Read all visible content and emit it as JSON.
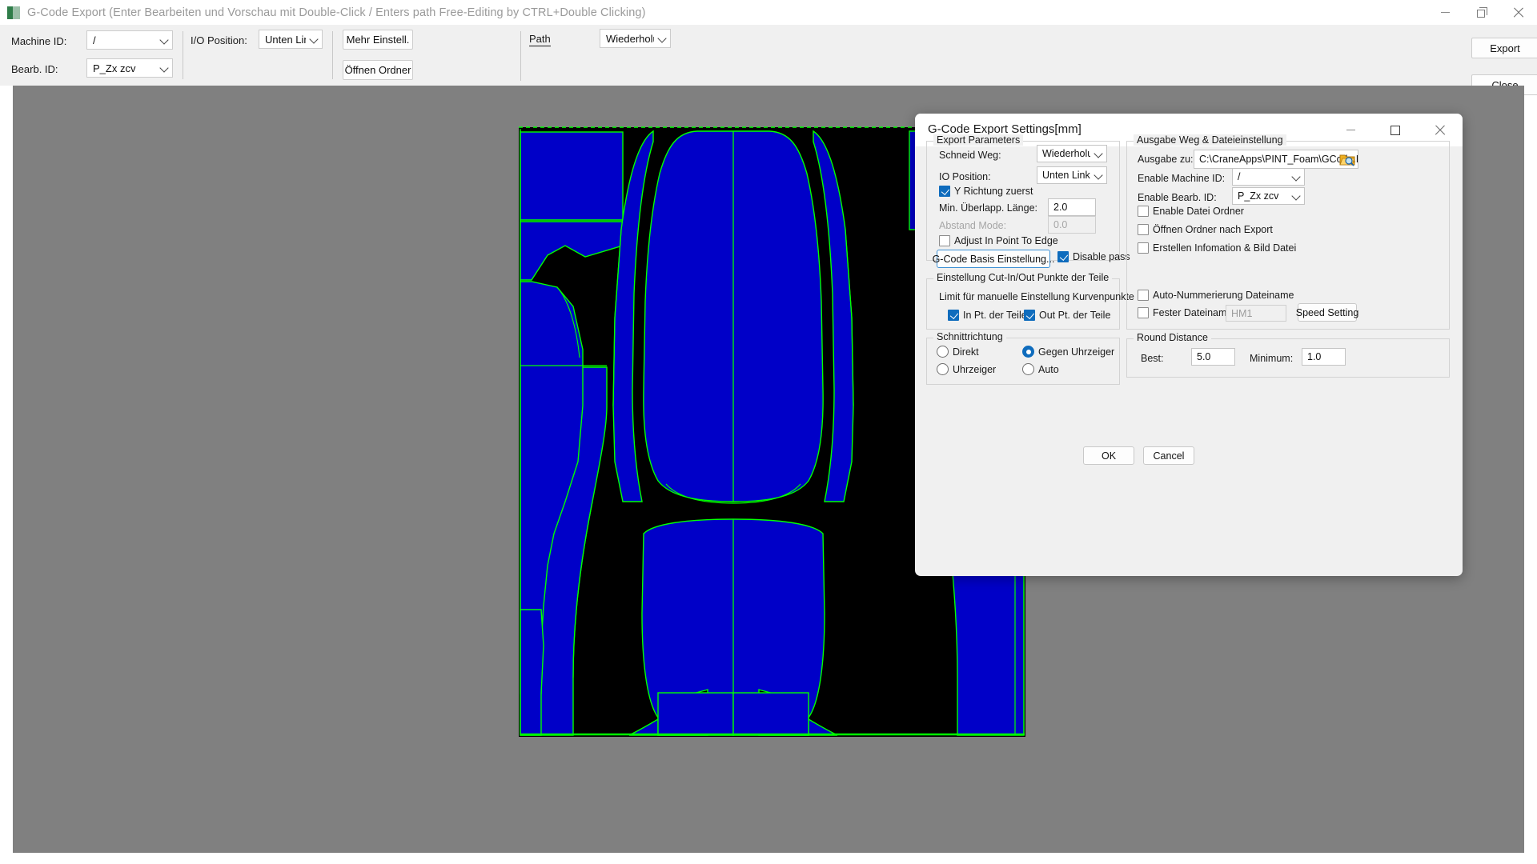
{
  "main_window": {
    "title": "G-Code Export (Enter Bearbeiten und Vorschau mit Double-Click / Enters path Free-Editing by CTRL+Double Clicking)",
    "icon": "app-icon",
    "controls": {
      "minimize": "minimize-icon",
      "restore": "restore-icon",
      "close": "close-icon"
    }
  },
  "toolbar": {
    "machine_id_label": "Machine ID:",
    "machine_id_value": "/",
    "bearb_id_label": "Bearb. ID:",
    "bearb_id_value": "P_Zx zcv",
    "io_position_label": "I/O Position:",
    "io_position_value": "Unten Linl",
    "y_richtung_label": "Y Richtung zuerst",
    "y_richtung_checked": true,
    "mehr_einstell_label": "Mehr Einstell.",
    "oeffnen_ordner_label": "Öffnen Ordner",
    "path_label": "Path",
    "path_value": "Wiederholu",
    "export_label": "Export",
    "close_label": "Close"
  },
  "dialog": {
    "title": "G-Code Export Settings[mm]",
    "controls": {
      "minimize": "minimize-icon",
      "maximize": "maximize-icon",
      "close": "close-icon"
    },
    "export_parameters": {
      "group_label": "Export Parameters",
      "schneid_weg_label": "Schneid Weg:",
      "schneid_weg_value": "Wiederholung",
      "io_position_label": "IO Position:",
      "io_position_value": "Unten Links",
      "y_richtung_label": "Y Richtung zuerst",
      "y_richtung_checked": true,
      "min_ueberlapp_label": "Min. Überlapp. Länge:",
      "min_ueberlapp_value": "2.0",
      "abstand_mode_label": "Abstand Mode:",
      "abstand_mode_value": "0.0",
      "abstand_mode_disabled": true,
      "adjust_in_point_label": "Adjust In Point To Edge",
      "adjust_in_point_checked": false,
      "gcode_basis_button": "G-Code Basis Einstellung...",
      "disable_pass_label": "Disable pass",
      "disable_pass_checked": true
    },
    "cut_points": {
      "group_label": "Einstellung Cut-In/Out Punkte der Teile",
      "limit_label": "Limit für manuelle Einstellung Kurvenpunkte",
      "in_pt_label": "In Pt. der Teile",
      "in_pt_checked": true,
      "out_pt_label": "Out Pt. der Teile",
      "out_pt_checked": true
    },
    "schnittrichtung": {
      "group_label": "Schnittrichtung",
      "options": [
        {
          "label": "Direkt",
          "selected": false
        },
        {
          "label": "Gegen Uhrzeiger",
          "selected": true
        },
        {
          "label": "Uhrzeiger",
          "selected": false
        },
        {
          "label": "Auto",
          "selected": false
        }
      ]
    },
    "ausgabe": {
      "group_label": "Ausgabe Weg & Dateieinstellung",
      "ausgabe_zu_label": "Ausgabe zu:",
      "ausgabe_zu_value": "C:\\CraneApps\\PINT_Foam\\GCode.Fil",
      "browse_icon": "folder-browse-icon",
      "enable_machine_id_label": "Enable Machine ID:",
      "enable_machine_id_value": "/",
      "enable_bearb_id_label": "Enable Bearb. ID:",
      "enable_bearb_id_value": "P_Zx zcv",
      "enable_datei_ordner_label": "Enable Datei Ordner",
      "enable_datei_ordner_checked": false,
      "oeffnen_ordner_label": "Öffnen Ordner nach Export",
      "oeffnen_ordner_checked": false,
      "erstellen_info_label": "Erstellen Infomation & Bild Datei",
      "erstellen_info_checked": false,
      "auto_nummerierung_label": "Auto-Nummerierung Dateiname",
      "auto_nummerierung_checked": false,
      "fester_dateiname_label": "Fester Dateiname:",
      "fester_dateiname_checked": false,
      "fester_dateiname_placeholder": "HM1",
      "speed_setting_button": "Speed Setting"
    },
    "round_distance": {
      "group_label": "Round Distance",
      "best_label": "Best:",
      "best_value": "5.0",
      "minimum_label": "Minimum:",
      "minimum_value": "1.0"
    },
    "ok_label": "OK",
    "cancel_label": "Cancel"
  },
  "canvas": {
    "background_color": "#808080",
    "sheet_color": "#000000",
    "part_fill_color": "#0000c8",
    "outline_color": "#00ff00"
  }
}
